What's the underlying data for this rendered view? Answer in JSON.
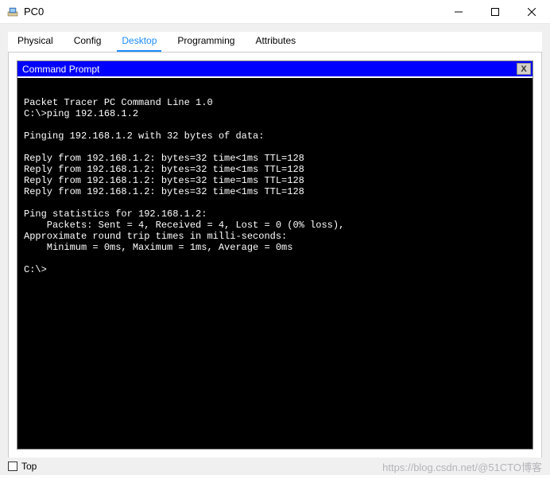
{
  "window": {
    "title": "PC0"
  },
  "tabs": [
    {
      "label": "Physical"
    },
    {
      "label": "Config"
    },
    {
      "label": "Desktop"
    },
    {
      "label": "Programming"
    },
    {
      "label": "Attributes"
    }
  ],
  "cmd": {
    "title": "Command Prompt",
    "close": "X",
    "lines": [
      "",
      "Packet Tracer PC Command Line 1.0",
      "C:\\>ping 192.168.1.2",
      "",
      "Pinging 192.168.1.2 with 32 bytes of data:",
      "",
      "Reply from 192.168.1.2: bytes=32 time<1ms TTL=128",
      "Reply from 192.168.1.2: bytes=32 time<1ms TTL=128",
      "Reply from 192.168.1.2: bytes=32 time=1ms TTL=128",
      "Reply from 192.168.1.2: bytes=32 time<1ms TTL=128",
      "",
      "Ping statistics for 192.168.1.2:",
      "    Packets: Sent = 4, Received = 4, Lost = 0 (0% loss),",
      "Approximate round trip times in milli-seconds:",
      "    Minimum = 0ms, Maximum = 1ms, Average = 0ms",
      "",
      "C:\\>"
    ]
  },
  "bottom": {
    "top_label": "Top"
  },
  "watermark": "https://blog.csdn.net/@51CTO博客"
}
